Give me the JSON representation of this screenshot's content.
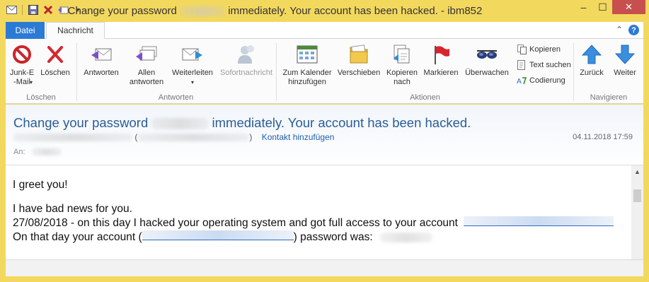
{
  "window": {
    "title_prefix": "Change your password",
    "title_suffix": "immediately. Your account has been hacked. - ibm852",
    "minimize": "–",
    "maximize": "☐",
    "close": "✕"
  },
  "tabs": {
    "file": "Datei",
    "message": "Nachricht",
    "collapse": "⌃",
    "help": "?"
  },
  "ribbon": {
    "groups": {
      "delete": "Löschen",
      "respond": "Antworten",
      "actions": "Aktionen",
      "navigate": "Navigieren"
    },
    "buttons": {
      "junk_line1": "Junk-E",
      "junk_line2": "-Mail",
      "delete": "Löschen",
      "reply": "Antworten",
      "reply_all_line1": "Allen",
      "reply_all_line2": "antworten",
      "forward": "Weiterleiten",
      "instant_message": "Sofortnachricht",
      "calendar_line1": "Zum Kalender",
      "calendar_line2": "hinzufügen",
      "move": "Verschieben",
      "copy_to_line1": "Kopieren",
      "copy_to_line2": "nach",
      "flag": "Markieren",
      "watch": "Überwachen",
      "copy": "Kopieren",
      "find_text": "Text suchen",
      "encoding": "Codierung",
      "back": "Zurück",
      "forward_nav": "Weiter"
    }
  },
  "message": {
    "subject_prefix": "Change your password",
    "subject_suffix": "immediately. Your account has been hacked.",
    "add_contact": "Kontakt hinzufügen",
    "date": "04.11.2018 17:59",
    "to_label": "An:",
    "body": {
      "line1": "I greet you!",
      "line2": "I have bad news for you.",
      "line3": "27/08/2018 - on this day I hacked your operating system and got full access to your account",
      "line4_prefix": "On that day your account (",
      "line4_suffix": ") password was:"
    }
  },
  "colors": {
    "frame": "#f3d85e",
    "file_tab": "#2b7bd5",
    "subject": "#2a5d96",
    "link": "#1f5fae"
  }
}
